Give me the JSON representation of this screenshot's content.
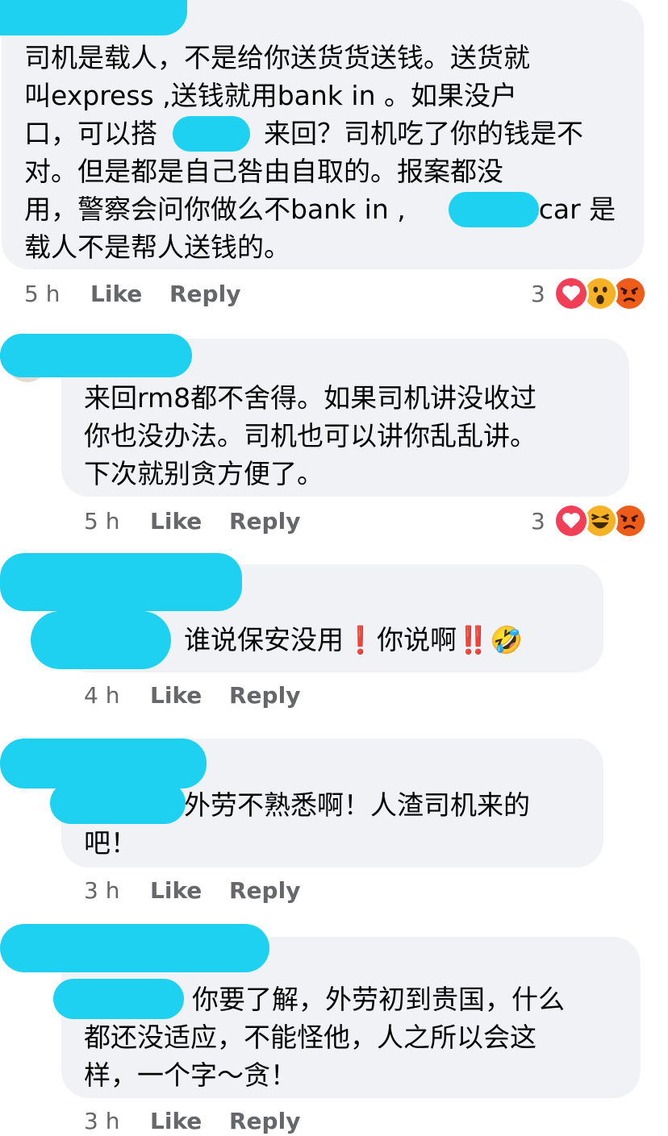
{
  "colors": {
    "bubble": "#f0f2f5",
    "redaction": "#1fd1f0",
    "meta_text": "#65676b",
    "love": "#f33e58",
    "wow": "#f7b125",
    "angry": "#e9710f"
  },
  "comments": [
    {
      "text": "司机是载人，不是给你送货货送钱。送货就\n叫express ,送钱就用bank in 。如果没户\n口，可以搭　　　　来回？司机吃了你的钱是不\n对。但是都是自己咎由自取的。报案都没\n用，警察会问你做么不bank in ,　　　　　car 是\n载人不是帮人送钱的。",
      "time": "5 h",
      "like": "Like",
      "reply": "Reply",
      "reaction_count": "3",
      "reactions": [
        "love-icon",
        "wow-icon",
        "angry-icon"
      ]
    },
    {
      "text": "来回rm8都不舍得。如果司机讲没收过\n你也没办法。司机也可以讲你乱乱讲。\n下次就别贪方便了。",
      "time": "5 h",
      "like": "Like",
      "reply": "Reply",
      "reaction_count": "3",
      "reactions": [
        "love-icon",
        "haha-icon",
        "angry-icon"
      ]
    },
    {
      "text": "谁说保安没用❗你说啊‼️🤣",
      "time": "4 h",
      "like": "Like",
      "reply": "Reply"
    },
    {
      "text": "外劳不熟悉啊！人渣司机来的\n吧！",
      "time": "3 h",
      "like": "Like",
      "reply": "Reply"
    },
    {
      "text": "你要了解，外劳初到贵国，什么\n都还没适应，不能怪他，人之所以会这\n样，一个字～贪！",
      "time": "3 h",
      "like": "Like",
      "reply": "Reply"
    }
  ]
}
